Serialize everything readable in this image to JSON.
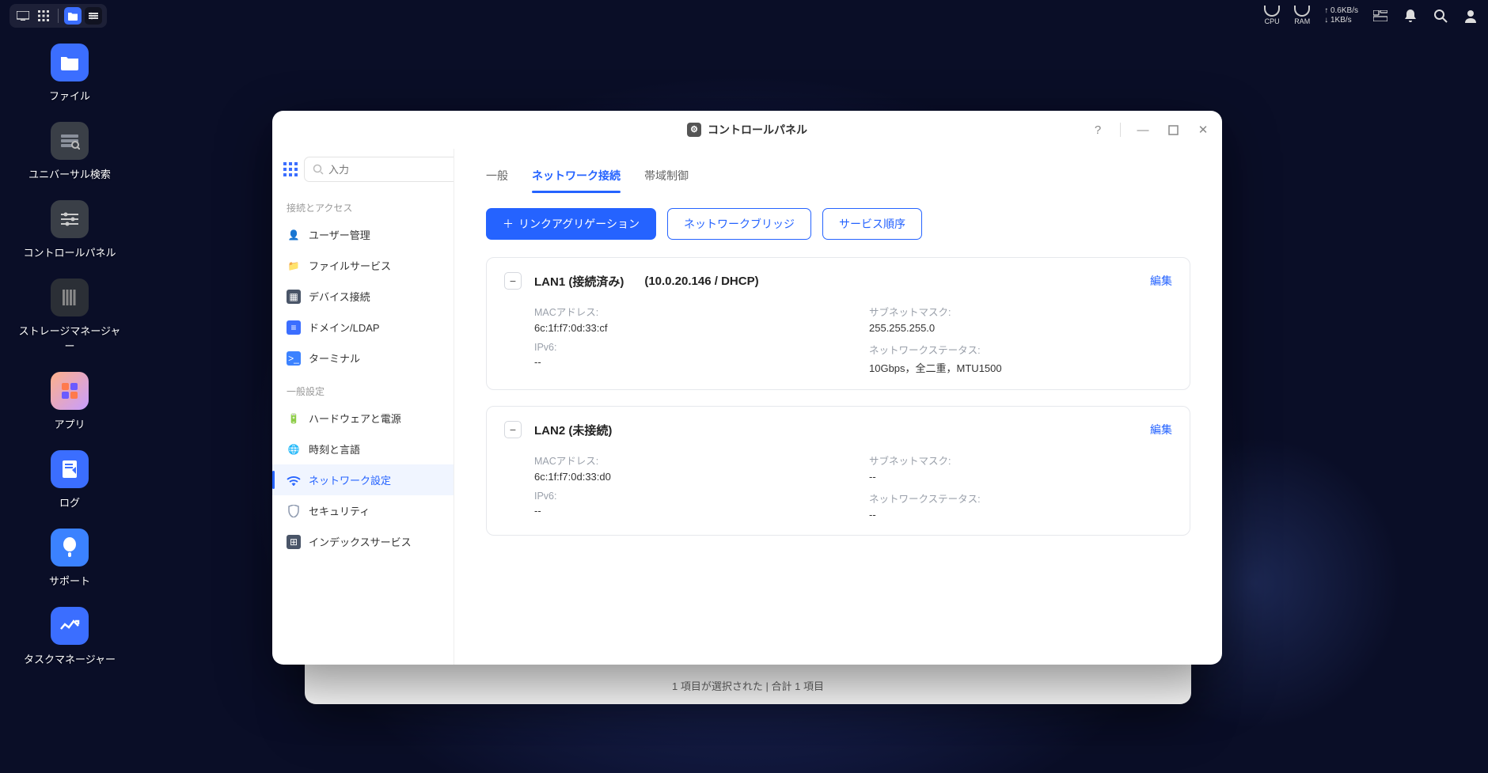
{
  "taskbar": {
    "cpu_label": "CPU",
    "ram_label": "RAM",
    "up_speed": "↑ 0.6KB/s",
    "down_speed": "↓ 1KB/s"
  },
  "desktop": {
    "icons": [
      {
        "label": "ファイル",
        "bg": "#3b6eff"
      },
      {
        "label": "ユニバーサル検索",
        "bg": "#3a3f47"
      },
      {
        "label": "コントロールパネル",
        "bg": "#3a3f47"
      },
      {
        "label": "ストレージマネージャー",
        "bg": "#2b2f36"
      },
      {
        "label": "アプリ",
        "bg": "linear-gradient(135deg,#ff8a65,#7c5cff)"
      },
      {
        "label": "ログ",
        "bg": "#3b6eff"
      },
      {
        "label": "サポート",
        "bg": "#3b82ff"
      },
      {
        "label": "タスクマネージャー",
        "bg": "#3b6eff"
      }
    ]
  },
  "window": {
    "title": "コントロールパネル",
    "search_placeholder": "入力"
  },
  "sidebar": {
    "section1": "接続とアクセス",
    "section2": "一般設定",
    "items1": [
      {
        "label": "ユーザー管理",
        "iconbg": "#6fa8ff"
      },
      {
        "label": "ファイルサービス",
        "iconbg": "#ff9a3b"
      },
      {
        "label": "デバイス接続",
        "iconbg": "#4a5568"
      },
      {
        "label": "ドメイン/LDAP",
        "iconbg": "#3b6eff"
      },
      {
        "label": "ターミナル",
        "iconbg": "#3b82ff"
      }
    ],
    "items2": [
      {
        "label": "ハードウェアと電源",
        "iconbg": "#8bbf5e"
      },
      {
        "label": "時刻と言語",
        "iconbg": "#3b6eff"
      },
      {
        "label": "ネットワーク設定",
        "iconbg": "#3b6eff",
        "active": true
      },
      {
        "label": "セキュリティ",
        "iconbg": "#8d99ae"
      },
      {
        "label": "インデックスサービス",
        "iconbg": "#4a5568"
      }
    ]
  },
  "tabs": {
    "t1": "一般",
    "t2": "ネットワーク接続",
    "t3": "帯域制御"
  },
  "buttons": {
    "link_agg": "リンクアグリゲーション",
    "bridge": "ネットワークブリッジ",
    "order": "サービス順序"
  },
  "lan1": {
    "title": "LAN1 (接続済み)",
    "sub": "(10.0.20.146 / DHCP)",
    "edit": "編集",
    "mac_label": "MACアドレス:",
    "mac_value": "6c:1f:f7:0d:33:cf",
    "mask_label": "サブネットマスク:",
    "mask_value": "255.255.255.0",
    "ipv6_label": "IPv6:",
    "ipv6_value": "--",
    "status_label": "ネットワークステータス:",
    "status_value": "10Gbps，全二重，MTU1500"
  },
  "lan2": {
    "title": "LAN2 (未接続)",
    "edit": "編集",
    "mac_label": "MACアドレス:",
    "mac_value": "6c:1f:f7:0d:33:d0",
    "mask_label": "サブネットマスク:",
    "mask_value": "--",
    "ipv6_label": "IPv6:",
    "ipv6_value": "--",
    "status_label": "ネットワークステータス:",
    "status_value": "--"
  },
  "back_window": {
    "footer": "1 項目が選択された | 合計 1 項目"
  }
}
